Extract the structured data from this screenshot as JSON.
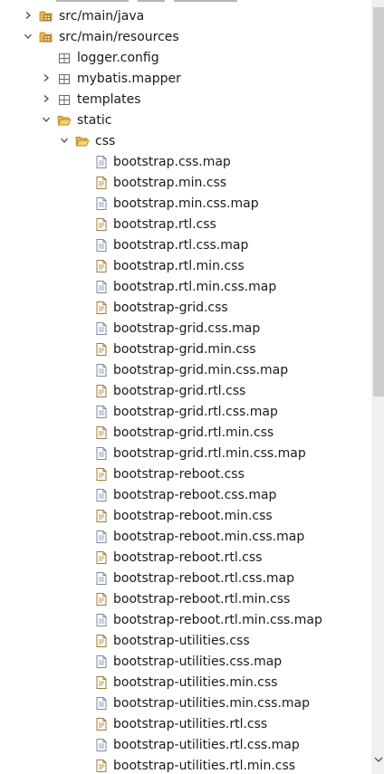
{
  "tree": {
    "items": [
      {
        "label": "src/main/java",
        "depth": 1,
        "chevron": "right",
        "icon": "package-folder-icon"
      },
      {
        "label": "src/main/resources",
        "depth": 1,
        "chevron": "down",
        "icon": "package-folder-icon"
      },
      {
        "label": "logger.config",
        "depth": 2,
        "chevron": "none",
        "icon": "package-icon"
      },
      {
        "label": "mybatis.mapper",
        "depth": 2,
        "chevron": "right",
        "icon": "package-icon"
      },
      {
        "label": "templates",
        "depth": 2,
        "chevron": "right",
        "icon": "package-icon"
      },
      {
        "label": "static",
        "depth": 2,
        "chevron": "down",
        "icon": "folder-open-icon"
      },
      {
        "label": "css",
        "depth": 3,
        "chevron": "down",
        "icon": "folder-open-icon"
      },
      {
        "label": "bootstrap.css.map",
        "depth": 4,
        "chevron": "none",
        "icon": "file-icon"
      },
      {
        "label": "bootstrap.min.css",
        "depth": 4,
        "chevron": "none",
        "icon": "css-file-icon"
      },
      {
        "label": "bootstrap.min.css.map",
        "depth": 4,
        "chevron": "none",
        "icon": "file-icon"
      },
      {
        "label": "bootstrap.rtl.css",
        "depth": 4,
        "chevron": "none",
        "icon": "css-file-icon"
      },
      {
        "label": "bootstrap.rtl.css.map",
        "depth": 4,
        "chevron": "none",
        "icon": "file-icon"
      },
      {
        "label": "bootstrap.rtl.min.css",
        "depth": 4,
        "chevron": "none",
        "icon": "css-file-icon"
      },
      {
        "label": "bootstrap.rtl.min.css.map",
        "depth": 4,
        "chevron": "none",
        "icon": "file-icon"
      },
      {
        "label": "bootstrap-grid.css",
        "depth": 4,
        "chevron": "none",
        "icon": "css-file-icon"
      },
      {
        "label": "bootstrap-grid.css.map",
        "depth": 4,
        "chevron": "none",
        "icon": "file-icon"
      },
      {
        "label": "bootstrap-grid.min.css",
        "depth": 4,
        "chevron": "none",
        "icon": "css-file-icon"
      },
      {
        "label": "bootstrap-grid.min.css.map",
        "depth": 4,
        "chevron": "none",
        "icon": "file-icon"
      },
      {
        "label": "bootstrap-grid.rtl.css",
        "depth": 4,
        "chevron": "none",
        "icon": "css-file-icon"
      },
      {
        "label": "bootstrap-grid.rtl.css.map",
        "depth": 4,
        "chevron": "none",
        "icon": "file-icon"
      },
      {
        "label": "bootstrap-grid.rtl.min.css",
        "depth": 4,
        "chevron": "none",
        "icon": "css-file-icon"
      },
      {
        "label": "bootstrap-grid.rtl.min.css.map",
        "depth": 4,
        "chevron": "none",
        "icon": "file-icon"
      },
      {
        "label": "bootstrap-reboot.css",
        "depth": 4,
        "chevron": "none",
        "icon": "css-file-icon"
      },
      {
        "label": "bootstrap-reboot.css.map",
        "depth": 4,
        "chevron": "none",
        "icon": "file-icon"
      },
      {
        "label": "bootstrap-reboot.min.css",
        "depth": 4,
        "chevron": "none",
        "icon": "css-file-icon"
      },
      {
        "label": "bootstrap-reboot.min.css.map",
        "depth": 4,
        "chevron": "none",
        "icon": "file-icon"
      },
      {
        "label": "bootstrap-reboot.rtl.css",
        "depth": 4,
        "chevron": "none",
        "icon": "css-file-icon"
      },
      {
        "label": "bootstrap-reboot.rtl.css.map",
        "depth": 4,
        "chevron": "none",
        "icon": "file-icon"
      },
      {
        "label": "bootstrap-reboot.rtl.min.css",
        "depth": 4,
        "chevron": "none",
        "icon": "css-file-icon"
      },
      {
        "label": "bootstrap-reboot.rtl.min.css.map",
        "depth": 4,
        "chevron": "none",
        "icon": "file-icon"
      },
      {
        "label": "bootstrap-utilities.css",
        "depth": 4,
        "chevron": "none",
        "icon": "css-file-icon"
      },
      {
        "label": "bootstrap-utilities.css.map",
        "depth": 4,
        "chevron": "none",
        "icon": "file-icon"
      },
      {
        "label": "bootstrap-utilities.min.css",
        "depth": 4,
        "chevron": "none",
        "icon": "css-file-icon"
      },
      {
        "label": "bootstrap-utilities.min.css.map",
        "depth": 4,
        "chevron": "none",
        "icon": "file-icon"
      },
      {
        "label": "bootstrap-utilities.rtl.css",
        "depth": 4,
        "chevron": "none",
        "icon": "css-file-icon"
      },
      {
        "label": "bootstrap-utilities.rtl.css.map",
        "depth": 4,
        "chevron": "none",
        "icon": "file-icon"
      },
      {
        "label": "bootstrap-utilities.rtl.min.css",
        "depth": 4,
        "chevron": "none",
        "icon": "css-file-icon"
      }
    ]
  },
  "colors": {
    "folder": "#e8b84a",
    "folder_stroke": "#b98a1e",
    "file_stroke": "#7a8aa6",
    "chevron": "#4a4a4a",
    "text": "#1a1a1a"
  }
}
